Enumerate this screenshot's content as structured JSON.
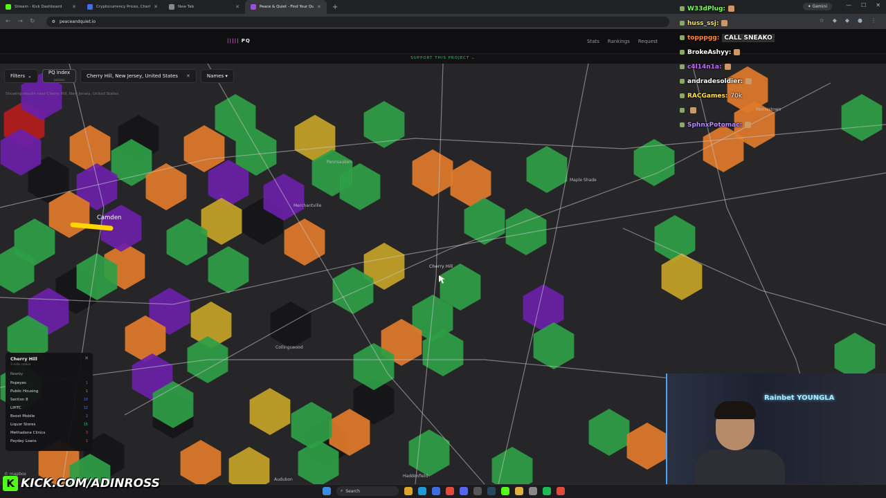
{
  "browser": {
    "tabs": [
      {
        "label": "Stream - Kick Dashboard",
        "color": "#53fc18"
      },
      {
        "label": "Cryptocurrency Prices, Charts a",
        "color": "#3d6cf5"
      },
      {
        "label": "New Tab",
        "color": "#888888"
      },
      {
        "label": "Peace & Quiet - Find Your Qui",
        "color": "#9a4de0"
      }
    ],
    "new_tab": "+",
    "gemini": "✦ Gemini",
    "url": "peaceandquiet.io"
  },
  "site": {
    "logo": "PQ",
    "nav": [
      "Stats",
      "Rankings",
      "Request"
    ],
    "support": "SUPPORT THIS PROJECT ⌄"
  },
  "toolbar": {
    "filters": "Filters",
    "pq_index": "PQ Index",
    "pq_sub": "(active)",
    "location": "Cherry Hill, New Jersey, United States",
    "names": "Names ▾",
    "showing": "Showing results near Cherry Hill, New Jersey, United States"
  },
  "map_labels": {
    "camden": "Camden",
    "cherry_hill": "Cherry Hill",
    "collingswood": "Collingswood",
    "maple_shade": "Maple Shade",
    "merchantville": "Merchantville",
    "pennsauken": "Pennsauken",
    "haddonfield": "Haddonfield",
    "moorestown": "Moorestown",
    "audubon": "Audubon"
  },
  "info_panel": {
    "title": "Cherry Hill",
    "subtitle": "3 mile radius",
    "nearby_label": "Nearby",
    "rows": [
      {
        "label": "Popeyes",
        "count": "1",
        "color": "#c040c0"
      },
      {
        "label": "Public Housing",
        "count": "1",
        "color": "#e08a3a"
      },
      {
        "label": "Section 8",
        "count": "10",
        "color": "#4a7ae0"
      },
      {
        "label": "LIHTC",
        "count": "12",
        "color": "#4a7ae0"
      },
      {
        "label": "Boost Mobile",
        "count": "2",
        "color": "#4a7ae0"
      },
      {
        "label": "Liquor Stores",
        "count": "15",
        "color": "#39c36a"
      },
      {
        "label": "Methadone Clinics",
        "count": "3",
        "color": "#e05050"
      },
      {
        "label": "Payday Loans",
        "count": "1",
        "color": "#e05050"
      }
    ]
  },
  "mapbox": "© mapbox",
  "chat": [
    {
      "user": "W33dPlug:",
      "color": "#7cff5a",
      "msg": ""
    },
    {
      "user": "huss_ssj:",
      "color": "#ffe14d",
      "msg": ""
    },
    {
      "user": "topppgg:",
      "color": "#ff8a3d",
      "msg": "CALL SNEAKO",
      "box": true
    },
    {
      "user": "BrokeAshyy:",
      "color": "#ffffff",
      "msg": ""
    },
    {
      "user": "c4l14n1a:",
      "color": "#c06bff",
      "msg": ""
    },
    {
      "user": "andradesoldier:",
      "color": "#ffffff",
      "msg": ""
    },
    {
      "user": "RACGames:",
      "color": "#ffe14d",
      "msg": "70k"
    },
    {
      "user": "",
      "color": "#ff4d4d",
      "msg": ""
    },
    {
      "user": "SphnxPotomac:",
      "color": "#b98bff",
      "msg": ""
    }
  ],
  "webcam": {
    "neon": "Rainbet YOUNGLA"
  },
  "kick_banner": {
    "k": "K",
    "text": "KICK.COM/ADINROSS"
  },
  "taskbar": {
    "search": "Search"
  },
  "colors": {
    "green": "#2e9e45",
    "orange": "#e07a2a",
    "yellow": "#c4a226",
    "purple": "#6a1fa8",
    "red": "#b51c1c"
  }
}
